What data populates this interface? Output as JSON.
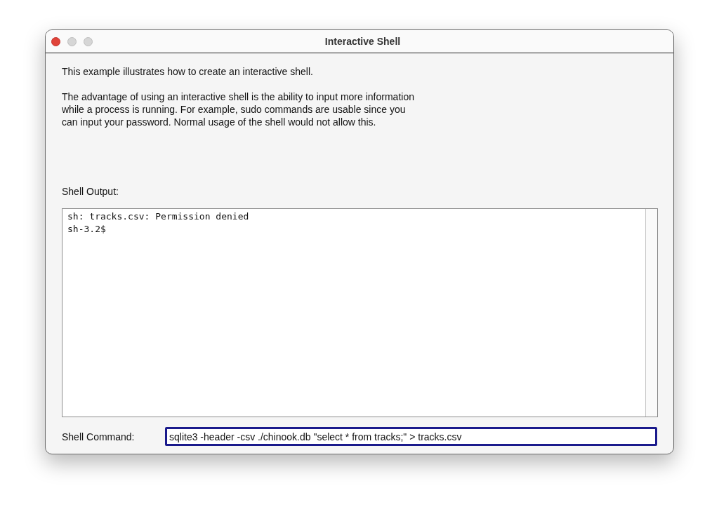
{
  "window": {
    "title": "Interactive Shell"
  },
  "intro": "This example illustrates how to create an interactive shell.",
  "description": [
    "The advantage of using an interactive shell is the ability to input more information",
    "while a process is running. For example, sudo commands are usable since you",
    "can input your password. Normal usage of the shell would not allow this."
  ],
  "output": {
    "label": "Shell Output:",
    "lines": [
      "sh: tracks.csv: Permission denied",
      "sh-3.2$"
    ]
  },
  "command": {
    "label": "Shell Command:",
    "value": "sqlite3 -header -csv ./chinook.db \"select * from tracks;\" > tracks.csv",
    "focused": true
  }
}
